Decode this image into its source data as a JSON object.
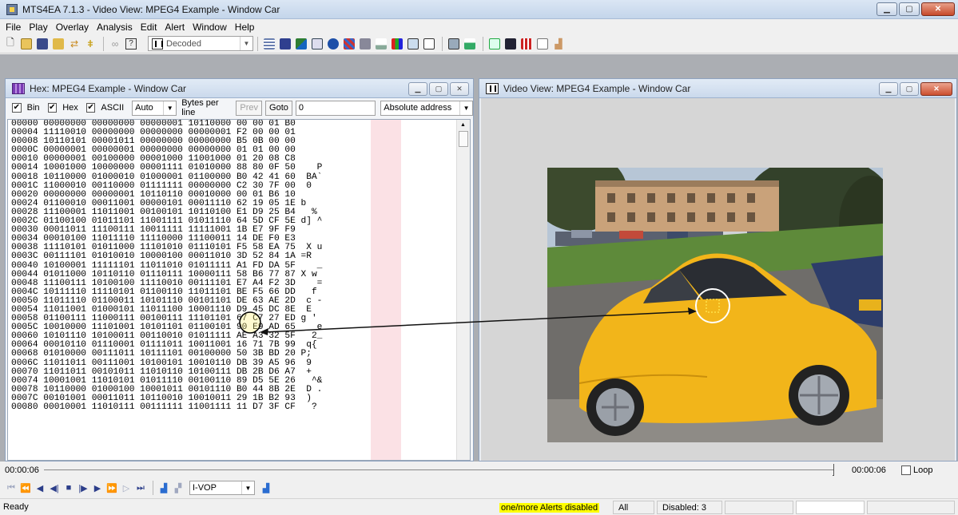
{
  "window": {
    "title": "MTS4EA 7.1.3 - Video View: MPEG4 Example - Window Car"
  },
  "menu": [
    "File",
    "Play",
    "Overlay",
    "Analysis",
    "Edit",
    "Alert",
    "Window",
    "Help"
  ],
  "toolbar": {
    "mode_value": "Decoded"
  },
  "hex_window": {
    "title": "Hex: MPEG4 Example - Window Car",
    "bin_label": "Bin",
    "hex_label": "Hex",
    "ascii_label": "ASCII",
    "bin_checked": true,
    "hex_checked": true,
    "ascii_checked": true,
    "bytes_per_line_value": "Auto",
    "bytes_per_line_label": "Bytes per line",
    "prev_label": "Prev",
    "goto_label": "Goto",
    "goto_value": "0",
    "address_mode": "Absolute address",
    "lines": [
      "00000 00000000 00000000 00000001 10110000 00 00 01 B0",
      "00004 11110010 00000000 00000000 00000001 F2 00 00 01",
      "00008 10110101 00001011 00000000 00000000 B5 0B 00 00",
      "0000C 00000001 00000001 00000000 00000000 01 01 00 00",
      "00010 00000001 00100000 00001000 11001000 01 20 08 C8",
      "00014 10001000 10000000 00001111 01010000 88 80 0F 50    P",
      "00018 10110000 01000010 01000001 01100000 B0 42 41 60  BA`",
      "0001C 11000010 00110000 01111111 00000000 C2 30 7F 00  0",
      "00020 00000000 00000001 10110110 00010000 00 01 B6 10",
      "00024 01100010 00011001 00000101 00011110 62 19 05 1E b",
      "00028 11100001 11011001 00100101 10110100 E1 D9 25 B4   %",
      "0002C 01100100 01011101 11001111 01011110 64 5D CF 5E d] ^",
      "00030 00011011 11100111 10011111 11111001 1B E7 9F F9",
      "00034 00010100 11011110 11110000 11100011 14 DE F0 E3",
      "00038 11110101 01011000 11101010 01110101 F5 58 EA 75  X u",
      "0003C 00111101 01010010 10000100 00011010 3D 52 84 1A =R",
      "00040 10100001 11111101 11011010 01011111 A1 FD DA 5F    _",
      "00044 01011000 10110110 01110111 10000111 58 B6 77 87 X w",
      "00048 11100111 10100100 11110010 00111101 E7 A4 F2 3D    =",
      "0004C 10111110 11110101 01100110 11011101 BE F5 66 DD   f",
      "00050 11011110 01100011 10101110 00101101 DE 63 AE 2D  c -",
      "00054 11011001 01000101 11011100 10001110 D9 45 DC 8E  E",
      "00058 01100111 11000111 00100111 11101101 67 C7 27 ED g '",
      "0005C 10010000 11101001 10101101 01100101 90 E9 AD 65    e",
      "00060 10101110 10100011 00110010 01011111 AE A3 32 5F   2_",
      "00064 00010110 01110001 01111011 10011001 16 71 7B 99  q{",
      "00068 01010000 00111011 10111101 00100000 50 3B BD 20 P;",
      "0006C 11011011 00111001 10100101 10010110 DB 39 A5 96  9",
      "00070 11011011 00101011 11010110 10100111 DB 2B D6 A7  +",
      "00074 10001001 11010101 01011110 00100110 89 D5 5E 26   ^&",
      "00078 10110000 01000100 10001011 00101110 B0 44 8B 2E  D .",
      "0007C 00101001 00011011 10110010 10010011 29 1B B2 93  )",
      "00080 00010001 11010111 00111111 11001111 11 D7 3F CF   ?"
    ]
  },
  "video_window": {
    "title": "Video View: MPEG4 Example - Window Car"
  },
  "timeline": {
    "current_time": "00:00:06",
    "end_time": "00:00:06",
    "position_fraction": 1.0,
    "loop_label": "Loop",
    "loop_checked": false
  },
  "transport": {
    "frame_type": "I-VOP"
  },
  "status": {
    "ready": "Ready",
    "alerts": "one/more Alerts disabled",
    "filter": "All",
    "disabled_count": "Disabled: 3"
  },
  "colors": {
    "ascii_highlight": "#fbe1e5",
    "alert_highlight": "#ffff00",
    "car": "#f2b51a"
  }
}
